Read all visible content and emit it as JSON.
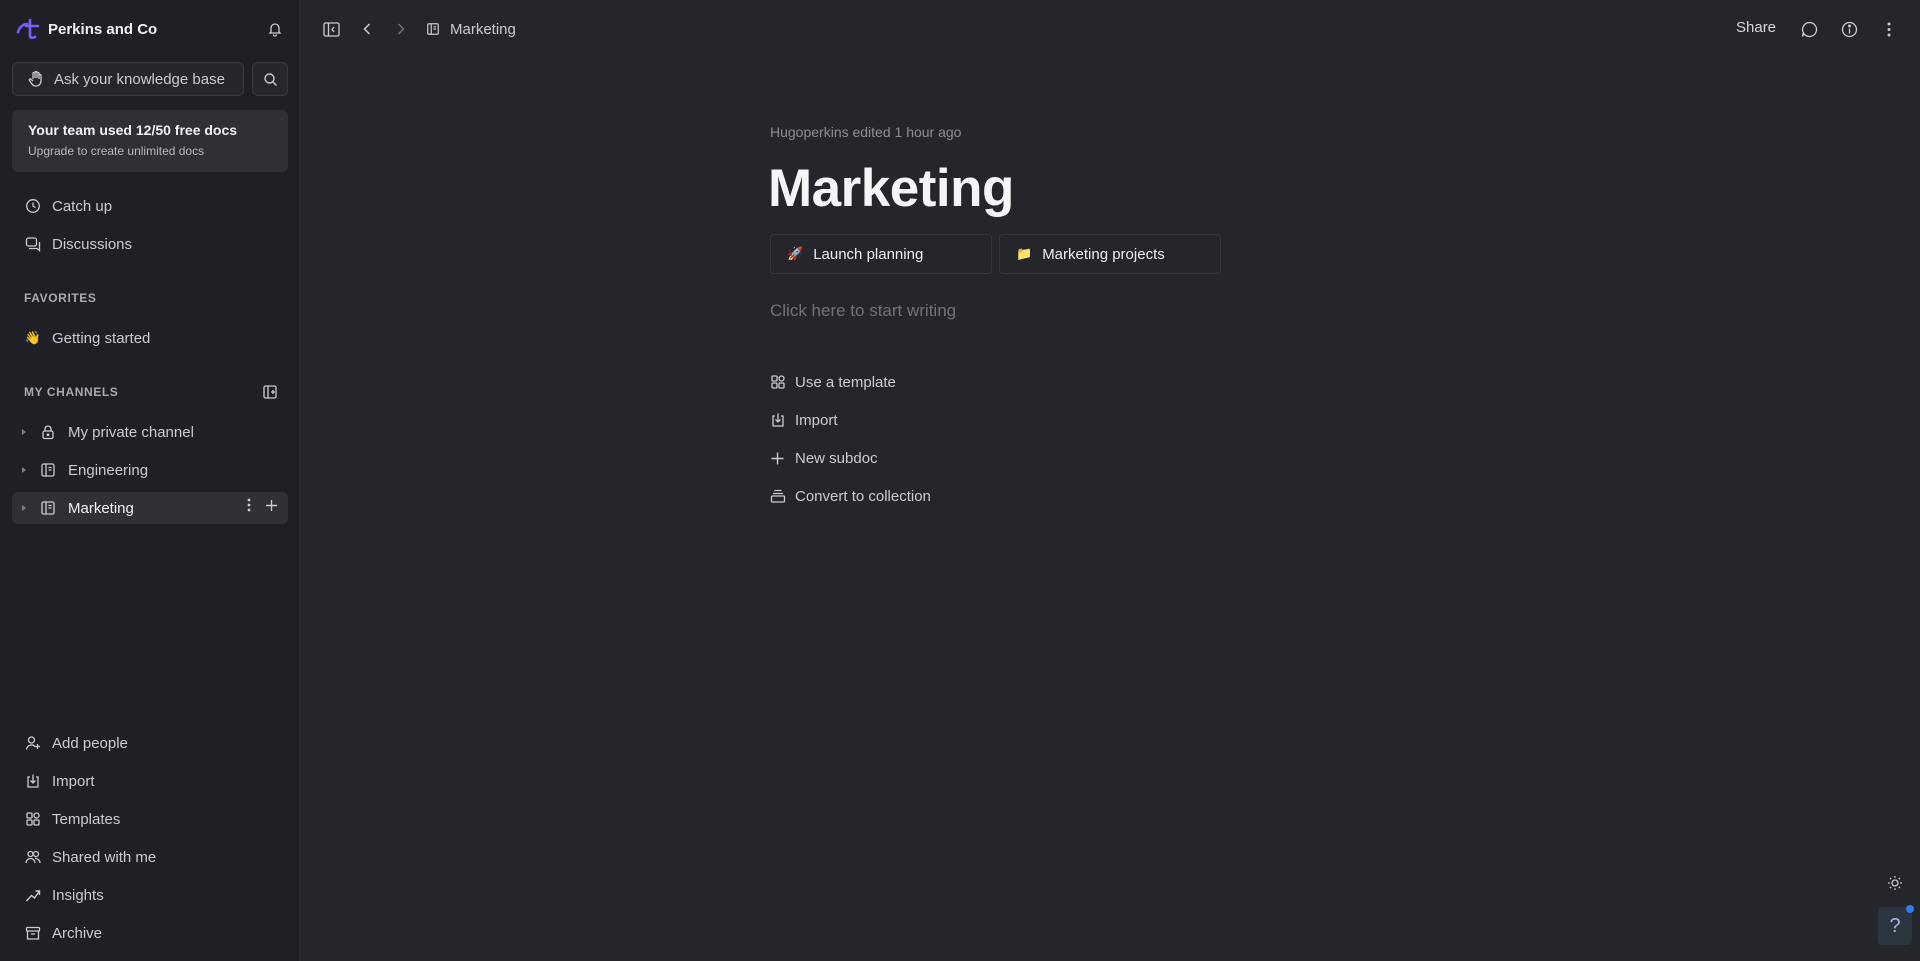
{
  "workspace": {
    "name": "Perkins and Co"
  },
  "search": {
    "placeholder": "Ask your knowledge base"
  },
  "upgrade": {
    "title": "Your team used 12/50 free docs",
    "subtitle": "Upgrade to create unlimited docs"
  },
  "nav_top": [
    {
      "label": "Catch up",
      "icon": "clock-icon"
    },
    {
      "label": "Discussions",
      "icon": "chat-icon"
    }
  ],
  "favorites": {
    "heading": "FAVORITES",
    "items": [
      {
        "emoji": "👋",
        "label": "Getting started"
      }
    ]
  },
  "channels": {
    "heading": "MY CHANNELS",
    "items": [
      {
        "label": "My private channel",
        "icon": "lock-icon",
        "active": false
      },
      {
        "label": "Engineering",
        "icon": "doc-icon",
        "active": false
      },
      {
        "label": "Marketing",
        "icon": "doc-icon",
        "active": true
      }
    ]
  },
  "nav_bottom": [
    {
      "label": "Add people",
      "icon": "add-user-icon"
    },
    {
      "label": "Import",
      "icon": "import-icon"
    },
    {
      "label": "Templates",
      "icon": "templates-icon"
    },
    {
      "label": "Shared with me",
      "icon": "people-icon"
    },
    {
      "label": "Insights",
      "icon": "trend-icon"
    },
    {
      "label": "Archive",
      "icon": "archive-icon"
    }
  ],
  "topbar": {
    "breadcrumb": "Marketing",
    "share_label": "Share"
  },
  "doc": {
    "meta": "Hugoperkins edited 1 hour ago",
    "title": "Marketing",
    "subdocs": [
      {
        "emoji": "🚀",
        "label": "Launch planning"
      },
      {
        "emoji": "📁",
        "label": "Marketing projects"
      }
    ],
    "placeholder": "Click here to start writing",
    "actions": [
      {
        "label": "Use a template",
        "icon": "templates-icon"
      },
      {
        "label": "Import",
        "icon": "import-icon"
      },
      {
        "label": "New subdoc",
        "icon": "plus-icon"
      },
      {
        "label": "Convert to collection",
        "icon": "collection-icon"
      }
    ]
  },
  "help": {
    "label": "?"
  },
  "colors": {
    "accent": "#7c5cff",
    "sidebar_bg": "#1f2025",
    "main_bg": "#24262b",
    "active_item": "#2f3136"
  }
}
